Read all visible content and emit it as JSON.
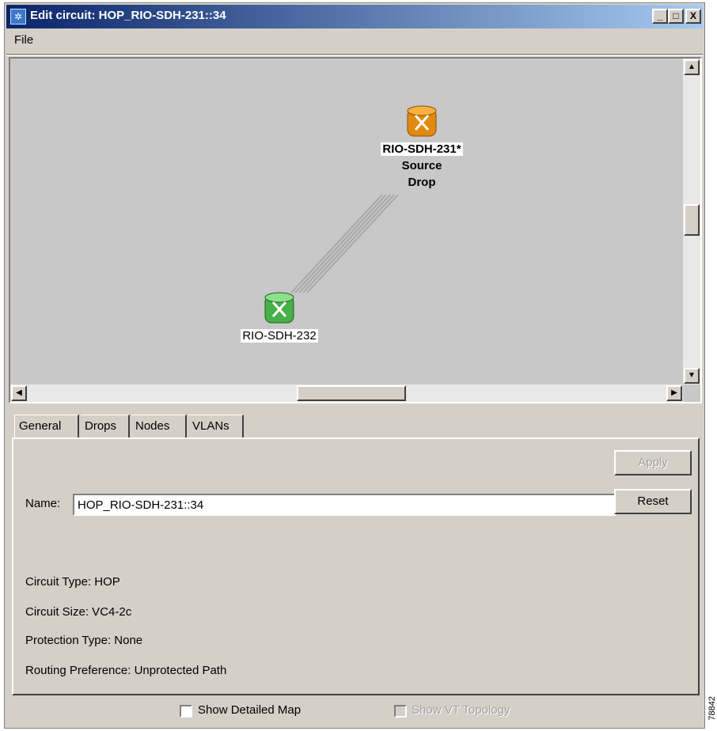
{
  "window": {
    "title": "Edit circuit: HOP_RIO-SDH-231::34",
    "min_label": "_",
    "max_label": "□",
    "close_label": "X"
  },
  "menu": {
    "file_label": "File"
  },
  "map": {
    "source_node": {
      "name": "RIO-SDH-231*",
      "line2": "Source",
      "line3": "Drop",
      "color": "#f0a020"
    },
    "dest_node": {
      "name": "RIO-SDH-232",
      "color": "#58c058"
    }
  },
  "tabs": [
    {
      "label": "General"
    },
    {
      "label": "Drops"
    },
    {
      "label": "Nodes"
    },
    {
      "label": "VLANs"
    }
  ],
  "general": {
    "apply_label": "Apply",
    "reset_label": "Reset",
    "name_label": "Name:",
    "name_value": "HOP_RIO-SDH-231::34",
    "circuit_type": "Circuit Type:  HOP",
    "circuit_size": "Circuit Size: VC4-2c",
    "protection_type": "Protection Type:  None",
    "routing_preference": "Routing Preference: Unprotected Path"
  },
  "bottom": {
    "show_detailed_map": "Show Detailed Map",
    "show_vt_topology": "Show VT Topology"
  },
  "watermark": "78842"
}
